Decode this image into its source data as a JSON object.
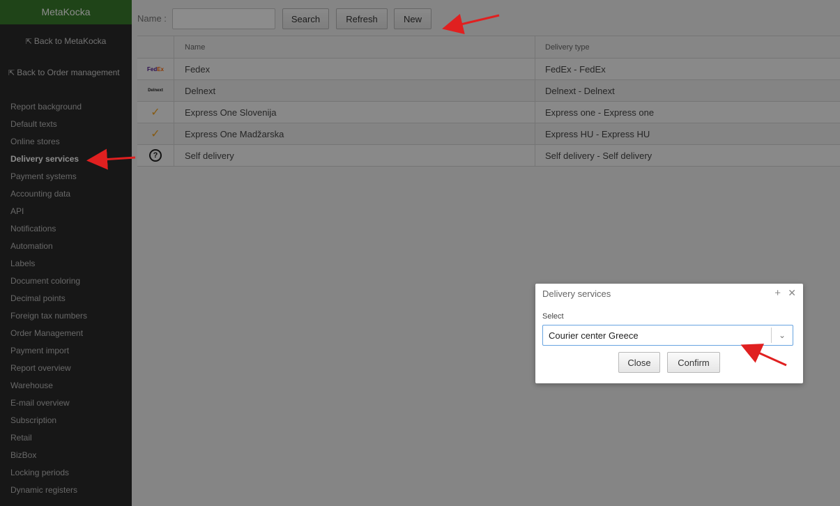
{
  "sidebar": {
    "brand": "MetaKocka",
    "back_metakocka": "Back to MetaKocka",
    "back_order": "Back to Order management",
    "items": [
      "Report background",
      "Default texts",
      "Online stores",
      "Delivery services",
      "Payment systems",
      "Accounting data",
      "API",
      "Notifications",
      "Automation",
      "Labels",
      "Document coloring",
      "Decimal points",
      "Foreign tax numbers",
      "Order Management",
      "Payment import",
      "Report overview",
      "Warehouse",
      "E-mail overview",
      "Subscription",
      "Retail",
      "BizBox",
      "Locking periods",
      "Dynamic registers"
    ],
    "active_item": "Delivery services"
  },
  "toolbar": {
    "name_label": "Name :",
    "search_value": "",
    "search_label": "Search",
    "refresh_label": "Refresh",
    "new_label": "New"
  },
  "grid": {
    "headers": {
      "name": "Name",
      "type": "Delivery type"
    },
    "rows": [
      {
        "icon": "fedex-logo",
        "name": "Fedex",
        "type": "FedEx - FedEx"
      },
      {
        "icon": "delnext-logo",
        "name": "Delnext",
        "type": "Delnext - Delnext"
      },
      {
        "icon": "express-one-logo",
        "name": "Express One Slovenija",
        "type": "Express one - Express one"
      },
      {
        "icon": "express-one-logo",
        "name": "Express One Madžarska",
        "type": "Express HU - Express HU"
      },
      {
        "icon": "question-circle-icon",
        "name": "Self delivery",
        "type": "Self delivery - Self delivery"
      }
    ]
  },
  "modal": {
    "title": "Delivery services",
    "select_label": "Select",
    "selected_value": "Courier center Greece",
    "close_label": "Close",
    "confirm_label": "Confirm"
  },
  "colors": {
    "brand_green": "#3a7d2c",
    "sidebar_bg": "#2b2b2b",
    "annotation_arrow": "#e02020",
    "select_border": "#66a3e0"
  }
}
